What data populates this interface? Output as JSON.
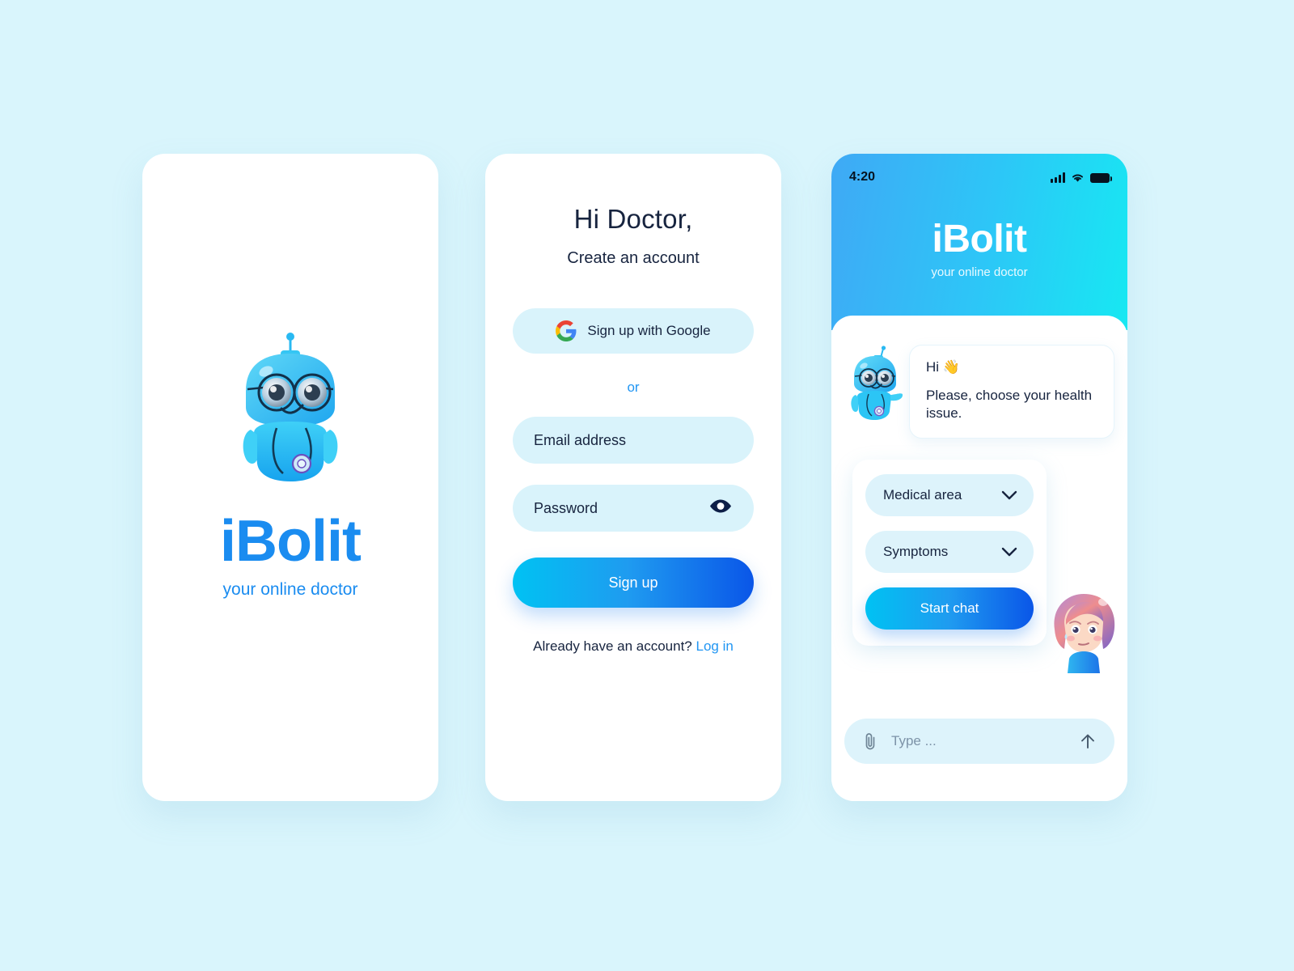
{
  "background_color": "#d9f5fc",
  "brand": {
    "name": "iBolit",
    "tagline": "your online doctor",
    "logo_color": "#1a8cf0",
    "gradient_start": "#3fa9f5",
    "gradient_end": "#17e8f2"
  },
  "screen_splash": {
    "robot_icon": "robot-doctor-illustration",
    "logo": "iBolit",
    "tagline": "your online doctor"
  },
  "screen_signup": {
    "greeting": "Hi Doctor,",
    "subtitle": "Create an account",
    "google_button": {
      "label": "Sign up with Google",
      "icon": "google-g-icon"
    },
    "divider": "or",
    "email_field": {
      "placeholder": "Email address",
      "value": ""
    },
    "password_field": {
      "placeholder": "Password",
      "value": "",
      "toggle_icon": "eye-icon"
    },
    "submit_label": "Sign up",
    "footer_text": "Already have an account?",
    "footer_link": "Log in"
  },
  "screen_chat": {
    "statusbar": {
      "time": "4:20",
      "signal_icon": "cellular-signal-icon",
      "wifi_icon": "wifi-icon",
      "battery_icon": "battery-full-icon"
    },
    "header": {
      "title": "iBolit",
      "tagline": "your online doctor"
    },
    "message": {
      "avatar_icon": "robot-doctor-avatar",
      "greeting": "Hi 👋",
      "body": "Please, choose your health issue."
    },
    "form": {
      "selects": [
        {
          "label": "Medical area",
          "icon": "chevron-down-icon"
        },
        {
          "label": "Symptoms",
          "icon": "chevron-down-icon"
        }
      ],
      "start_label": "Start chat"
    },
    "girl_icon": "worried-girl-illustration",
    "composer": {
      "attach_icon": "paperclip-icon",
      "placeholder": "Type ...",
      "value": "",
      "send_icon": "arrow-up-icon"
    }
  }
}
